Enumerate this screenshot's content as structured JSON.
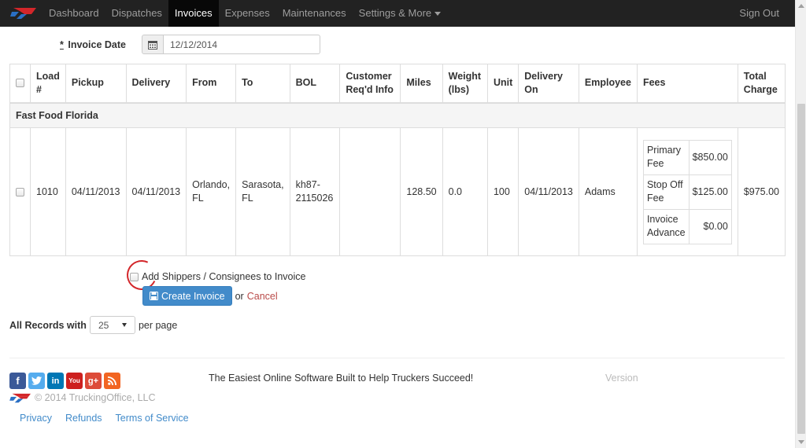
{
  "nav": {
    "items": [
      {
        "label": "Dashboard",
        "active": false
      },
      {
        "label": "Dispatches",
        "active": false
      },
      {
        "label": "Invoices",
        "active": true
      },
      {
        "label": "Expenses",
        "active": false
      },
      {
        "label": "Maintenances",
        "active": false
      },
      {
        "label": "Settings & More",
        "active": false
      }
    ],
    "signout": "Sign Out"
  },
  "invoice_date": {
    "required_mark": "*",
    "label": "Invoice Date",
    "value": "12/12/2014"
  },
  "table": {
    "headers": [
      "Load #",
      "Pickup",
      "Delivery",
      "From",
      "To",
      "BOL",
      "Customer Req'd Info",
      "Miles",
      "Weight (lbs)",
      "Unit",
      "Delivery On",
      "Employee",
      "Fees",
      "Total Charge"
    ],
    "group": "Fast Food Florida",
    "rows": [
      {
        "load": "1010",
        "pickup": "04/11/2013",
        "delivery": "04/11/2013",
        "from": "Orlando, FL",
        "to": "Sarasota, FL",
        "bol": "kh87-2115026",
        "customer_info": "",
        "miles": "128.50",
        "weight": "0.0",
        "unit": "100",
        "delivery_on": "04/11/2013",
        "employee": "Adams",
        "fees": [
          {
            "name": "Primary Fee",
            "amount": "$850.00"
          },
          {
            "name": "Stop Off Fee",
            "amount": "$125.00"
          },
          {
            "name": "Invoice Advance",
            "amount": "$0.00"
          }
        ],
        "total": "$975.00"
      }
    ]
  },
  "actions": {
    "shippers_label": "Add Shippers / Consignees to Invoice",
    "create_label": "Create Invoice",
    "or_text": "or",
    "cancel_label": "Cancel"
  },
  "records": {
    "label": "All Records with",
    "per_page_value": "25",
    "per_page_suffix": "per page"
  },
  "footer": {
    "tagline": "The Easiest Online Software Built to Help Truckers Succeed!",
    "version": "Version",
    "copyright": "© 2014 TruckingOffice, LLC",
    "links": [
      "Privacy",
      "Refunds",
      "Terms of Service"
    ]
  },
  "colors": {
    "navbar": "#222222",
    "primary": "#428bca",
    "cancel": "#b94a48",
    "annotation": "#d3262a"
  }
}
